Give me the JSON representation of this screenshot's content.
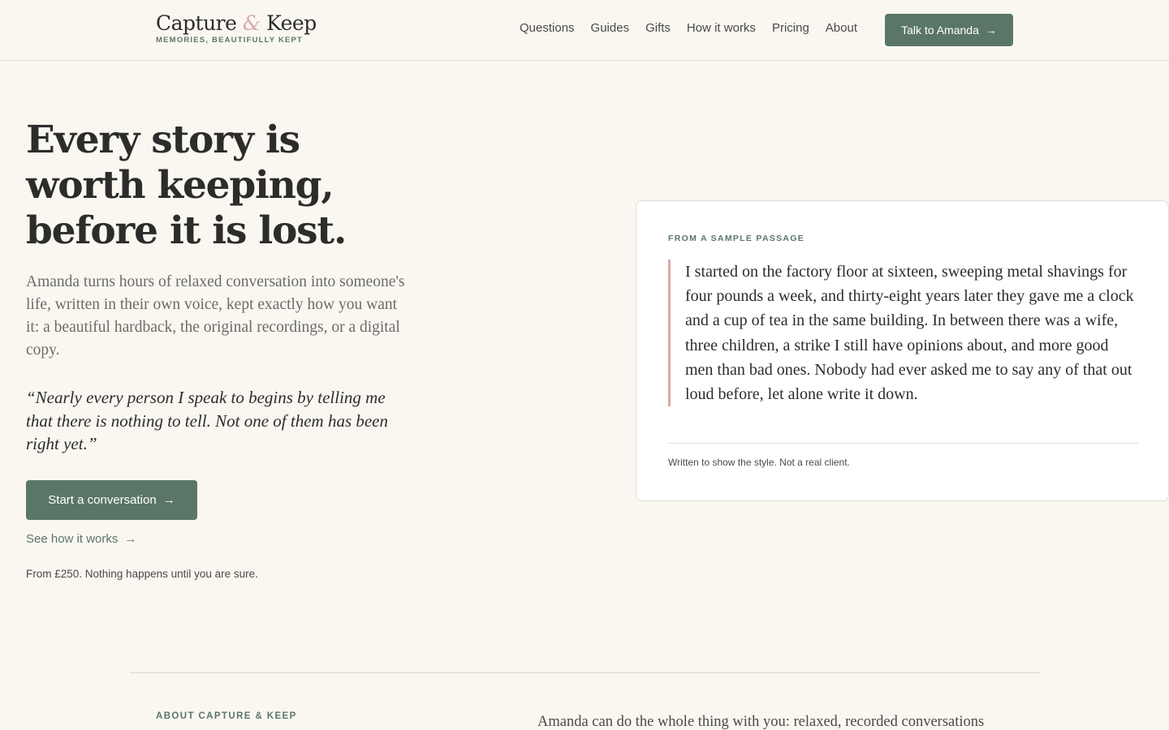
{
  "header": {
    "logo_word_1": "Capture",
    "logo_amp": "&",
    "logo_word_2": "Keep",
    "tagline": "MEMORIES, BEAUTIFULLY KEPT",
    "nav": [
      {
        "label": "Questions"
      },
      {
        "label": "Guides"
      },
      {
        "label": "Gifts"
      },
      {
        "label": "How it works"
      },
      {
        "label": "Pricing"
      },
      {
        "label": "About"
      }
    ],
    "cta_label": "Talk to Amanda",
    "cta_icon": "arrow-right-icon"
  },
  "hero": {
    "title": "Every story is worth keeping, before it is lost.",
    "lead": "Amanda turns hours of relaxed conversation into someone's life, written in their own voice, kept exactly how you want it: a beautiful hardback, the original recordings, or a digital copy.",
    "quote": "“Nearly every person I speak to begins by telling me that there is nothing to tell. Not one of them has been right yet.”",
    "primary_button": "Start a conversation",
    "secondary_link": "See how it works",
    "price_note": "From £250. Nothing happens until you are sure."
  },
  "sample": {
    "label": "FROM A SAMPLE PASSAGE",
    "passage": "I started on the factory floor at sixteen, sweeping metal shavings for four pounds a week, and thirty-eight years later they gave me a clock and a cup of tea in the same building. In between there was a wife, three children, a strike I still have opinions about, and more good men than bad ones. Nobody had ever asked me to say any of that out loud before, let alone write it down.",
    "note": "Written to show the style. Not a real client."
  },
  "about": {
    "label": "ABOUT CAPTURE & KEEP",
    "text": "Amanda can do the whole thing with you: relaxed, recorded conversations"
  },
  "colors": {
    "accent": "#5a7667",
    "accent_soft": "#d8aaa8",
    "background": "#faf7f1"
  }
}
